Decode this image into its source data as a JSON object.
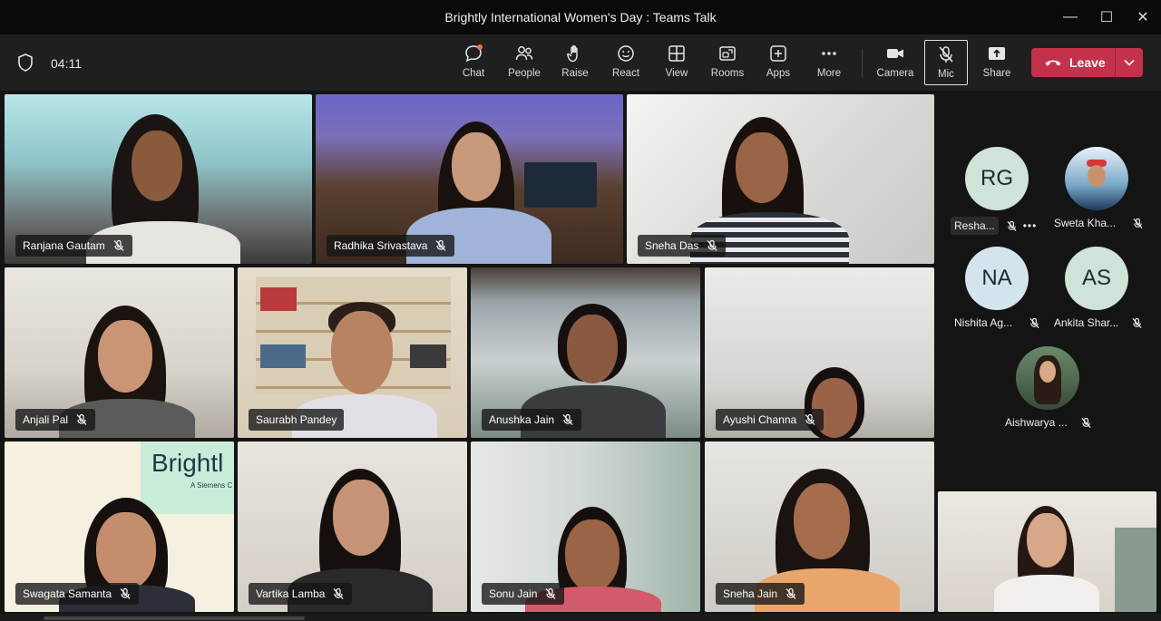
{
  "window": {
    "title": "Brightly International Women's Day : Teams Talk",
    "minimize": "—",
    "maximize": "☐",
    "close": "✕"
  },
  "meeting": {
    "timer": "04:11"
  },
  "toolbar": {
    "chat": "Chat",
    "people": "People",
    "raise": "Raise",
    "react": "React",
    "view": "View",
    "rooms": "Rooms",
    "apps": "Apps",
    "more": "More",
    "camera": "Camera",
    "mic": "Mic",
    "share": "Share",
    "leave": "Leave"
  },
  "participants": [
    {
      "name": "Ranjana Gautam"
    },
    {
      "name": "Radhika Srivastava"
    },
    {
      "name": "Sneha Das"
    },
    {
      "name": "Anjali Pal"
    },
    {
      "name": "Saurabh Pandey"
    },
    {
      "name": "Anushka Jain"
    },
    {
      "name": "Ayushi Channa"
    },
    {
      "name": "Swagata Samanta"
    },
    {
      "name": "Vartika Lamba"
    },
    {
      "name": "Sonu Jain"
    },
    {
      "name": "Sneha Jain"
    }
  ],
  "logo_text": "Brightl",
  "logo_sub": "A Siemens C",
  "roster": [
    {
      "initials": "RG",
      "name": "Resha...",
      "color": "#cfe3d8"
    },
    {
      "initials": "",
      "name": "Sweta Kha...",
      "color": "#ffffff"
    },
    {
      "initials": "NA",
      "name": "Nishita Ag...",
      "color": "#d4e4ef"
    },
    {
      "initials": "AS",
      "name": "Ankita Shar...",
      "color": "#cfe3d8"
    },
    {
      "initials": "",
      "name": "Aishwarya ...",
      "color": "#3a3a3a"
    }
  ],
  "roster_more": "•••"
}
